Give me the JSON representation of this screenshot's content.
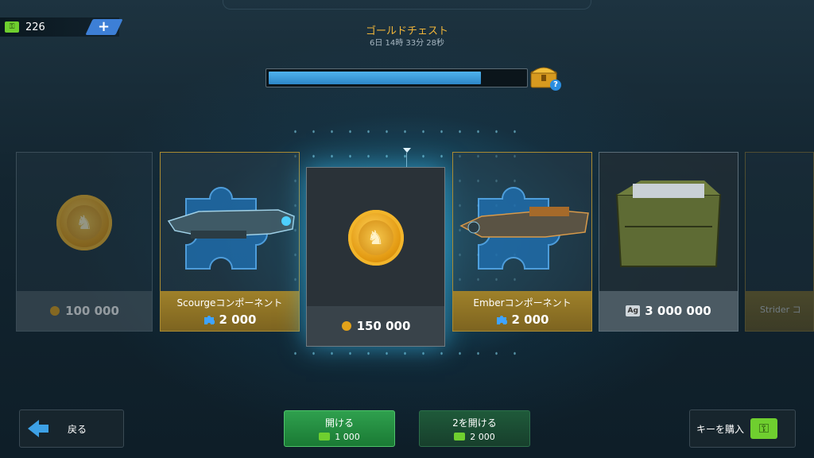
{
  "header": {
    "keys": "226",
    "title": "ゴールドチェスト",
    "timer": "6日 14時 33分 28秒",
    "progress": 0.83
  },
  "cards": [
    {
      "label": "",
      "price": "100 000",
      "currency": "medal-icon"
    },
    {
      "label": "Scourgeコンポーネント",
      "price": "2 000",
      "currency": "puzzle-icon"
    },
    {
      "label": "",
      "price": "150 000",
      "currency": "medal-icon"
    },
    {
      "label": "Emberコンポーネント",
      "price": "2 000",
      "currency": "puzzle-icon"
    },
    {
      "label": "",
      "price": "3 000 000",
      "currency": "silver-icon",
      "currency_text": "Ag"
    },
    {
      "label": "Strider コ",
      "price": "",
      "currency": "puzzle-icon"
    }
  ],
  "buttons": {
    "back": "戻る",
    "open": "開ける",
    "open_cost": "1 000",
    "open2": "2を開ける",
    "open2_cost": "2 000",
    "buy_keys": "キーを購入"
  },
  "colors": {
    "accent_gold": "#f0b53a",
    "progress_blue": "#3a9ee0",
    "key_green": "#6fcf2f"
  }
}
